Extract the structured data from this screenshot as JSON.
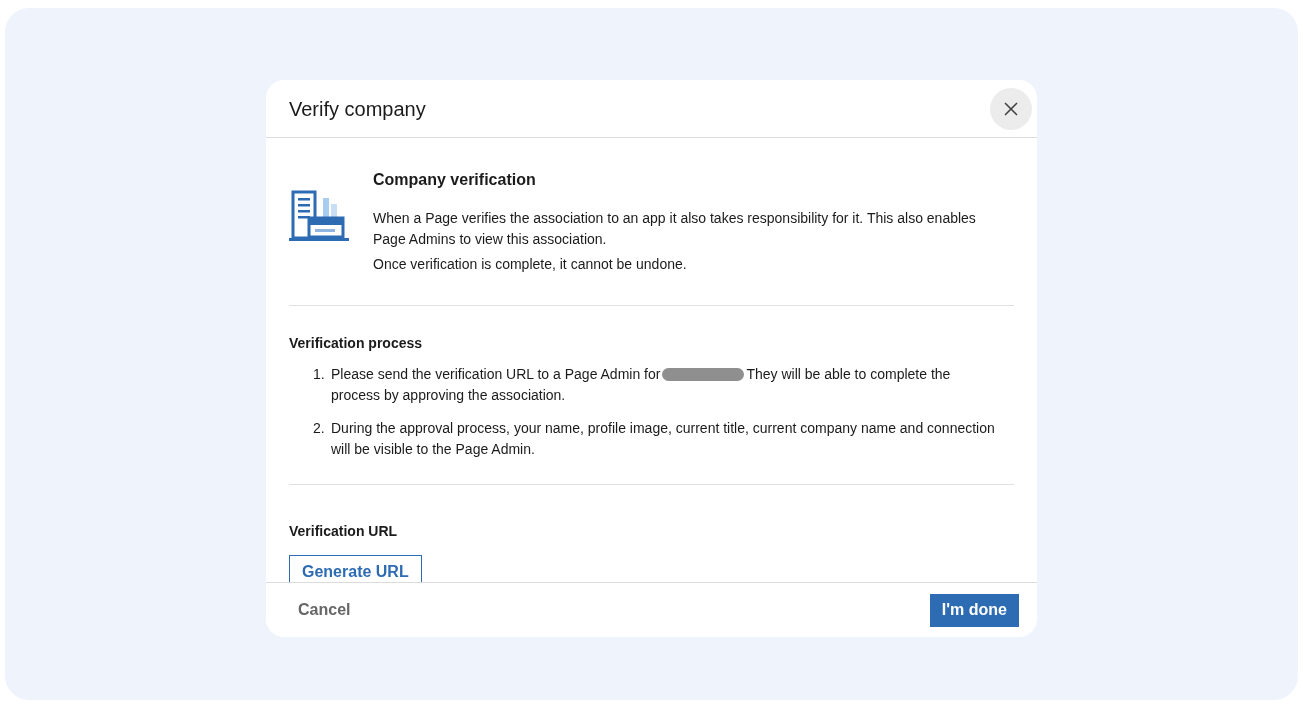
{
  "dialog": {
    "title": "Verify company",
    "intro": {
      "heading": "Company verification",
      "paragraphs": [
        "When a Page verifies the association to an app it also takes responsibility for it. This also enables Page Admins to view this association.",
        "Once verification is complete, it cannot be undone."
      ]
    },
    "process": {
      "heading": "Verification process",
      "steps": [
        {
          "number": "1.",
          "text_before": "Please send the verification URL to a Page Admin for",
          "redacted": true,
          "text_after": "They will be able to complete the",
          "continuation": "process by approving the association."
        },
        {
          "number": "2.",
          "text_before": "During the approval process, your name, profile image, current title, current company name and connection will be visible to the Page Admin.",
          "redacted": false
        }
      ]
    },
    "url": {
      "heading": "Verification URL",
      "button": "Generate URL"
    },
    "footer": {
      "cancel": "Cancel",
      "confirm": "I'm done"
    }
  }
}
